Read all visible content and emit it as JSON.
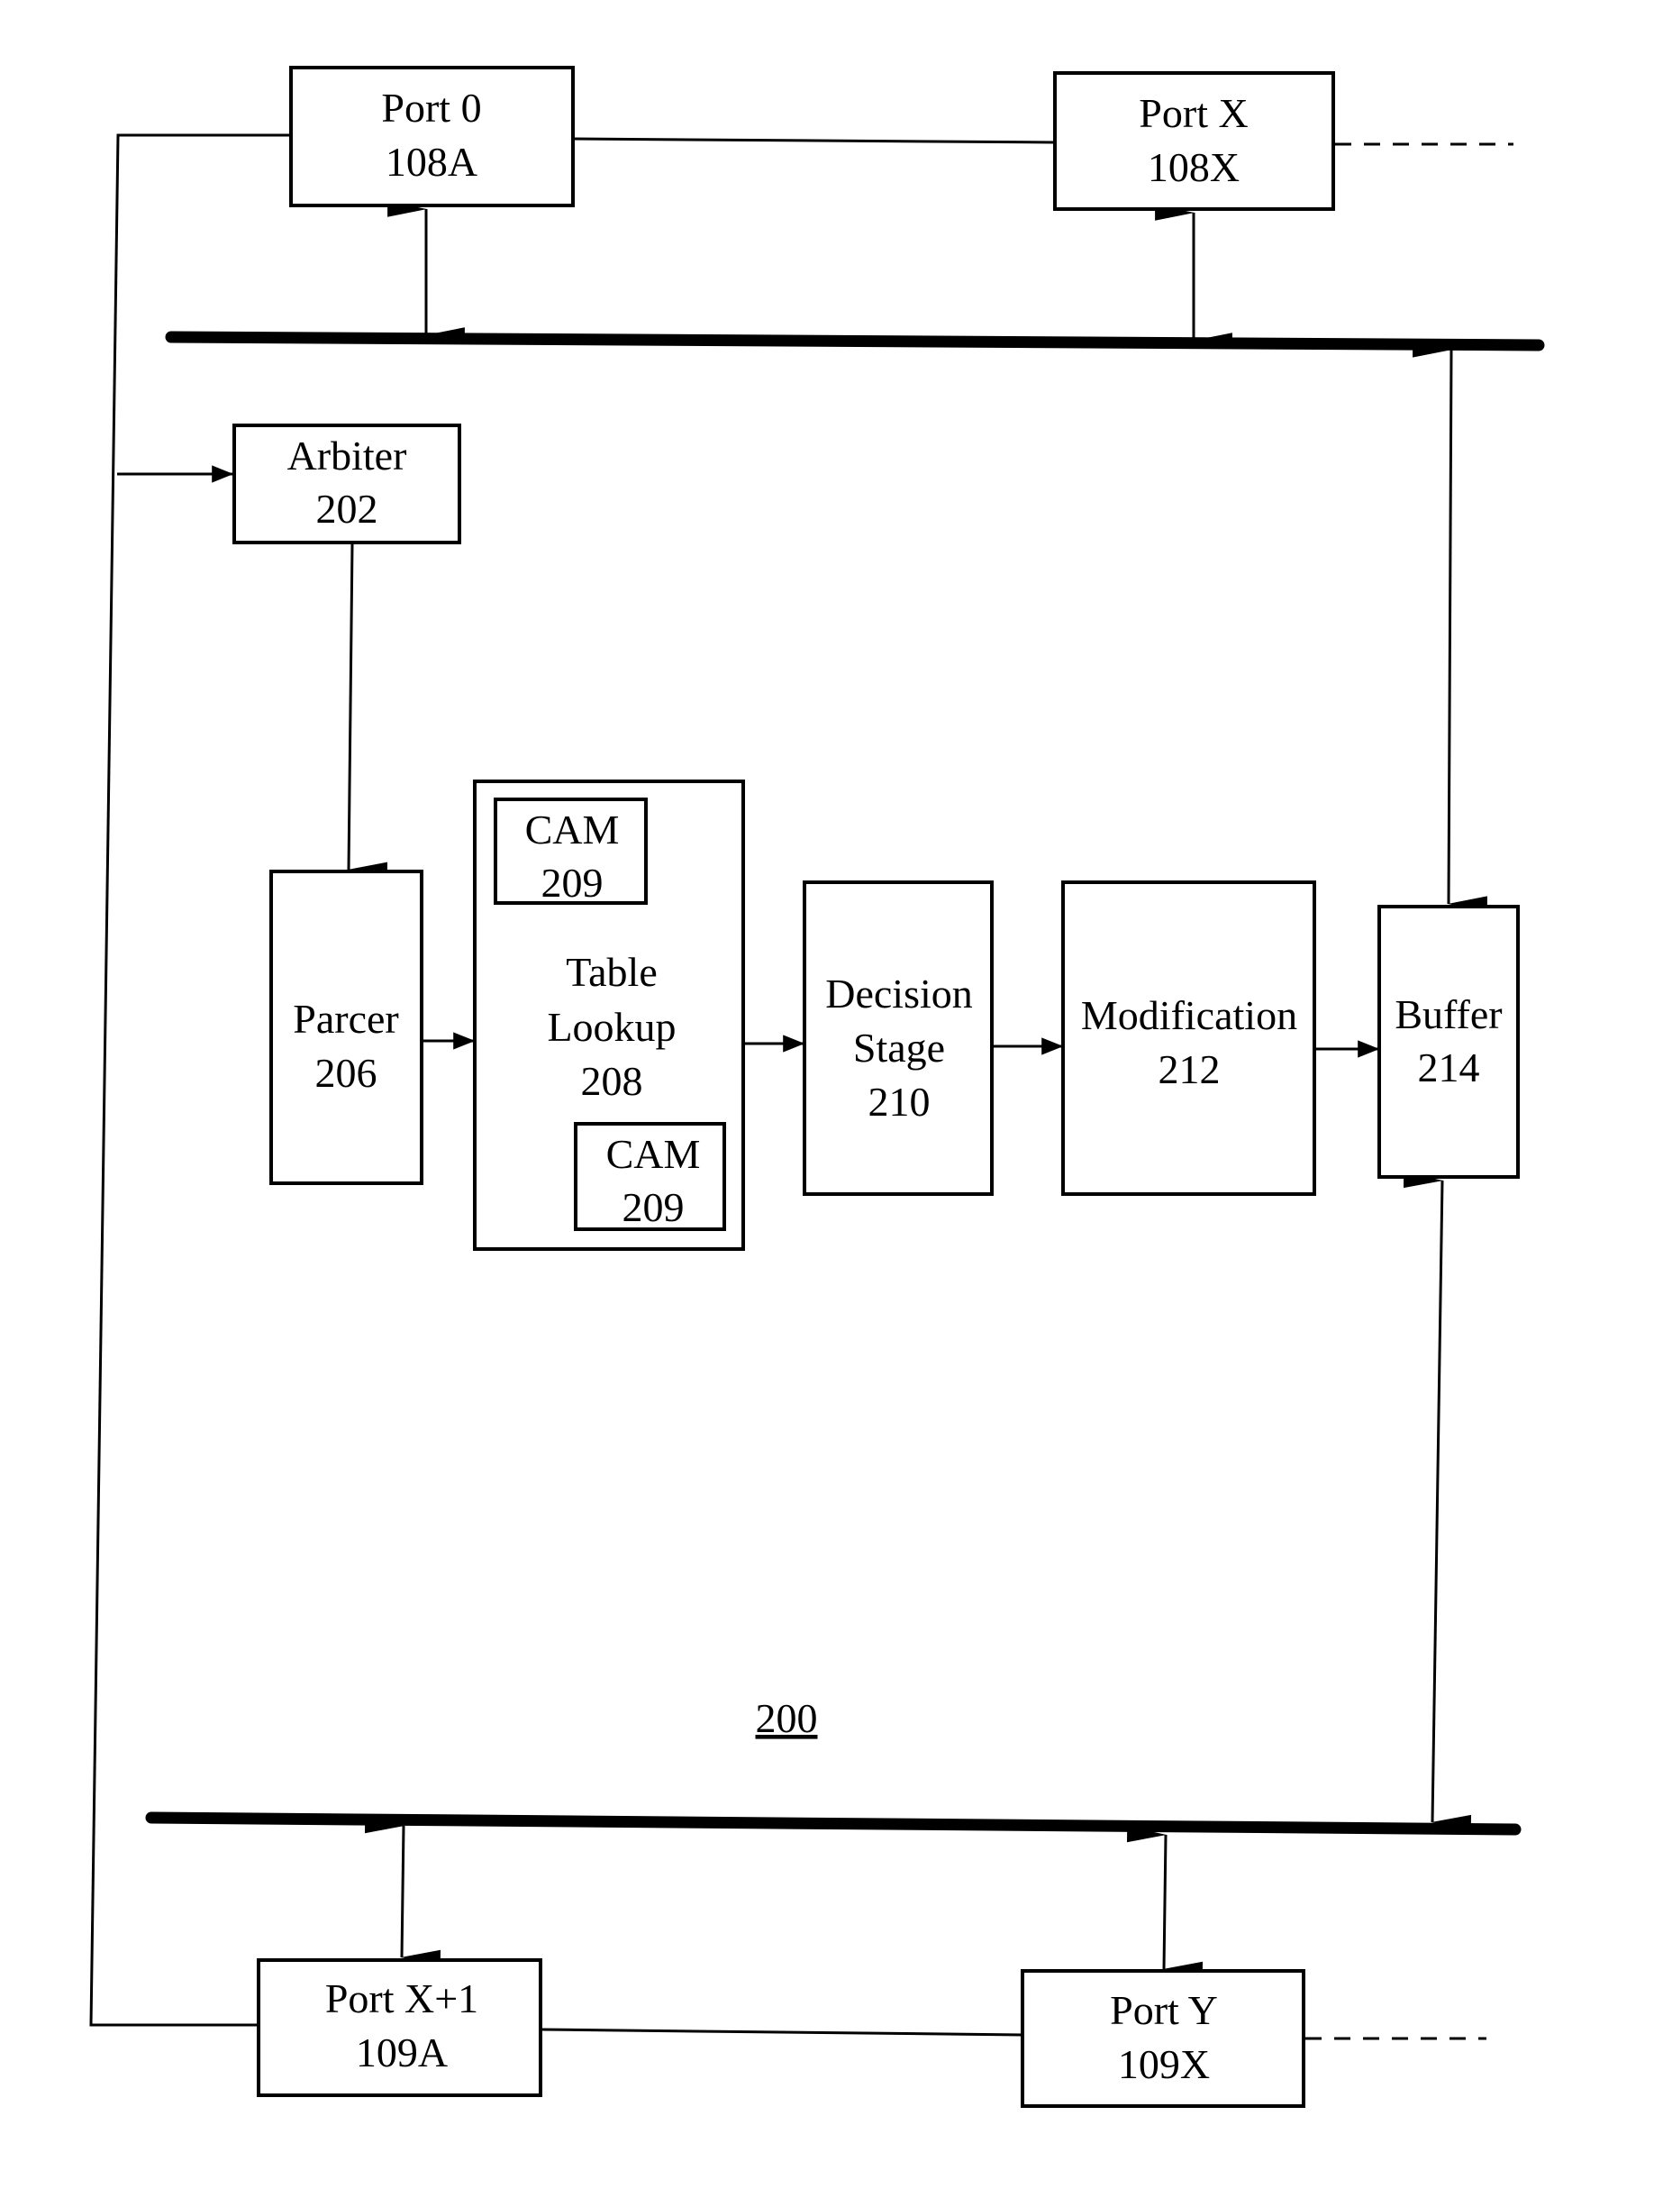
{
  "diagram": {
    "figure_label": "200",
    "ports_top": [
      {
        "name": "Port 0",
        "ref": "108A"
      },
      {
        "name": "Port X",
        "ref": "108X"
      }
    ],
    "ports_bottom": [
      {
        "name": "Port X+1",
        "ref": "109A"
      },
      {
        "name": "Port Y",
        "ref": "109X"
      }
    ],
    "blocks": {
      "arbiter": {
        "name": "Arbiter",
        "ref": "202"
      },
      "parcer": {
        "name": "Parcer",
        "ref": "206"
      },
      "table_lookup": {
        "line1": "Table",
        "line2": "Lookup",
        "ref": "208"
      },
      "cam_top": {
        "name": "CAM",
        "ref": "209"
      },
      "cam_bottom": {
        "name": "CAM",
        "ref": "209"
      },
      "decision": {
        "line1": "Decision",
        "line2": "Stage",
        "ref": "210"
      },
      "modification": {
        "name": "Modification",
        "ref": "212"
      },
      "buffer": {
        "name": "Buffer",
        "ref": "214"
      }
    },
    "connections": [
      {
        "from": "Port 0",
        "to": "top-bus",
        "type": "bidirectional"
      },
      {
        "from": "Port X",
        "to": "top-bus",
        "type": "bidirectional"
      },
      {
        "from": "Port 0",
        "to": "Port X",
        "type": "line"
      },
      {
        "from": "Port X",
        "to": "continuation",
        "type": "dashed"
      },
      {
        "from": "Port 0",
        "to": "Arbiter",
        "type": "arrow",
        "via": "left-rail"
      },
      {
        "from": "Port X+1",
        "to": "left-rail",
        "type": "line"
      },
      {
        "from": "Arbiter",
        "to": "Parcer",
        "type": "arrow"
      },
      {
        "from": "Parcer",
        "to": "Table Lookup",
        "type": "arrow"
      },
      {
        "from": "Table Lookup",
        "to": "Decision Stage",
        "type": "arrow"
      },
      {
        "from": "Decision Stage",
        "to": "Modification",
        "type": "arrow"
      },
      {
        "from": "Modification",
        "to": "Buffer",
        "type": "arrow"
      },
      {
        "from": "Buffer",
        "to": "top-bus",
        "type": "bidirectional"
      },
      {
        "from": "Buffer",
        "to": "bottom-bus",
        "type": "bidirectional"
      },
      {
        "from": "Port X+1",
        "to": "bottom-bus",
        "type": "bidirectional"
      },
      {
        "from": "Port Y",
        "to": "bottom-bus",
        "type": "bidirectional"
      },
      {
        "from": "Port X+1",
        "to": "Port Y",
        "type": "line"
      },
      {
        "from": "Port Y",
        "to": "continuation",
        "type": "dashed"
      }
    ]
  }
}
